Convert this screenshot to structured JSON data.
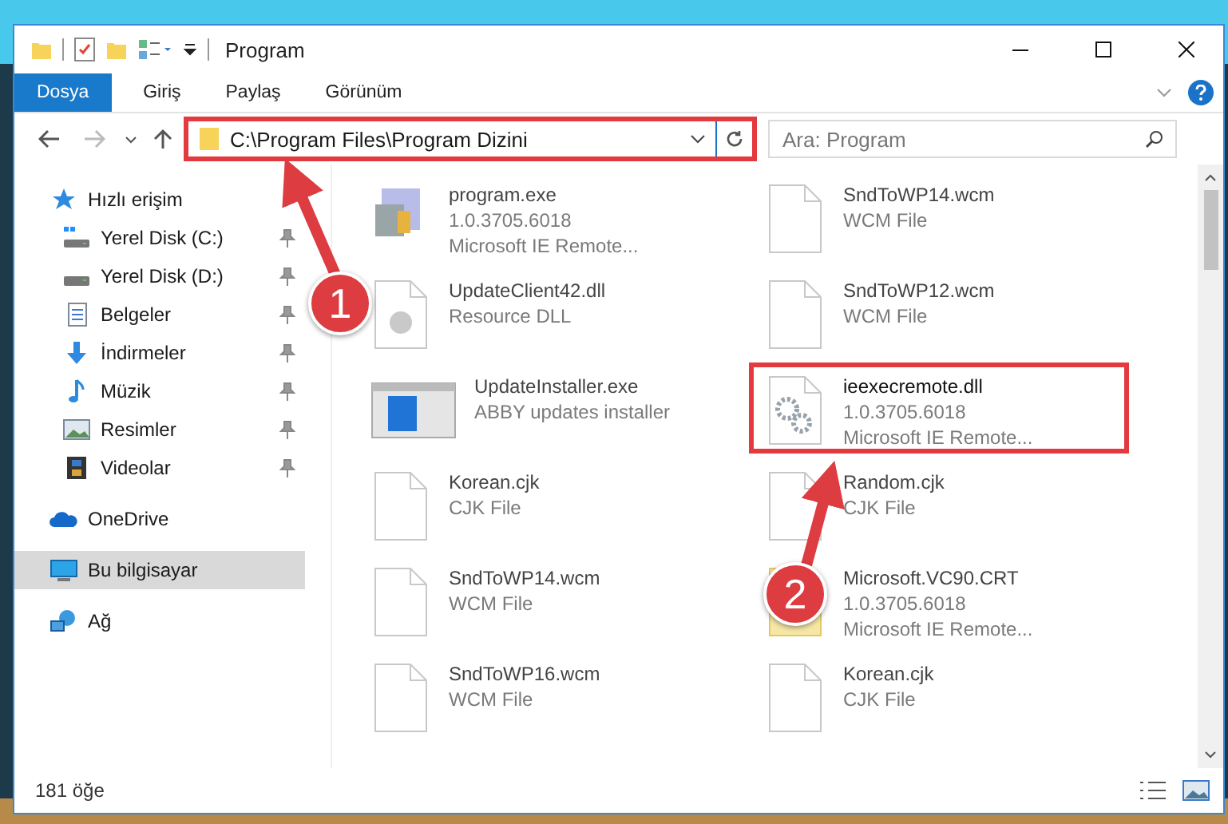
{
  "window": {
    "title": "Program"
  },
  "ribbon_tabs": [
    {
      "label": "Dosya",
      "kind": "file"
    },
    {
      "label": "Giriş",
      "kind": "tab"
    },
    {
      "label": "Paylaş",
      "kind": "tab"
    },
    {
      "label": "Görünüm",
      "kind": "tab"
    }
  ],
  "address": {
    "path": "C:\\Program Files\\Program Dizini",
    "highlighted": true
  },
  "search": {
    "placeholder": "Ara: Program"
  },
  "sidebar": {
    "items": [
      {
        "label": "Hızlı erişim",
        "kind": "star",
        "selected": false,
        "children": [
          {
            "label": "Yerel Disk (C:)",
            "kind": "drive-windows",
            "pinned": true,
            "selected": false
          },
          {
            "label": "Yerel Disk (D:)",
            "kind": "drive",
            "pinned": true,
            "selected": false
          },
          {
            "label": "Belgeler",
            "kind": "document",
            "pinned": true,
            "selected": false
          },
          {
            "label": "İndirmeler",
            "kind": "download",
            "pinned": true,
            "selected": false
          },
          {
            "label": "Müzik",
            "kind": "music",
            "pinned": true,
            "selected": false
          },
          {
            "label": "Resimler",
            "kind": "pictures",
            "pinned": true,
            "selected": false
          },
          {
            "label": "Videolar",
            "kind": "video",
            "pinned": true,
            "selected": false
          }
        ]
      },
      {
        "label": "OneDrive",
        "kind": "cloud",
        "selected": false
      },
      {
        "label": "Bu bilgisayar",
        "kind": "computer",
        "selected": true
      },
      {
        "label": "Ağ",
        "kind": "network",
        "selected": false
      }
    ]
  },
  "files": [
    {
      "name": "program.exe",
      "details": [
        "1.0.3705.6018",
        "Microsoft IE Remote..."
      ],
      "kind": "app",
      "highlighted": false
    },
    {
      "name": "SndToWP14.wcm",
      "details": [
        "WCM File"
      ],
      "kind": "blank",
      "highlighted": false
    },
    {
      "name": "UpdateClient42.dll",
      "details": [
        "Resource DLL"
      ],
      "kind": "dll",
      "highlighted": false
    },
    {
      "name": "SndToWP12.wcm",
      "details": [
        "WCM File"
      ],
      "kind": "blank",
      "highlighted": false
    },
    {
      "name": "UpdateInstaller.exe",
      "details": [
        "ABBY updates installer"
      ],
      "kind": "installer",
      "highlighted": false
    },
    {
      "name": "ieexecremote.dll",
      "details": [
        "1.0.3705.6018",
        "Microsoft IE Remote..."
      ],
      "kind": "gear",
      "highlighted": true
    },
    {
      "name": "Korean.cjk",
      "details": [
        "CJK File"
      ],
      "kind": "blank",
      "highlighted": false
    },
    {
      "name": "Random.cjk",
      "details": [
        "CJK File"
      ],
      "kind": "blank",
      "highlighted": false
    },
    {
      "name": "SndToWP14.wcm",
      "details": [
        "WCM File"
      ],
      "kind": "blank",
      "highlighted": false
    },
    {
      "name": "Microsoft.VC90.CRT",
      "details": [
        "1.0.3705.6018",
        "Microsoft IE Remote..."
      ],
      "kind": "manifest",
      "highlighted": false
    },
    {
      "name": "SndToWP16.wcm",
      "details": [
        "WCM File"
      ],
      "kind": "blank",
      "highlighted": false
    },
    {
      "name": "Korean.cjk",
      "details": [
        "CJK File"
      ],
      "kind": "blank",
      "highlighted": false
    }
  ],
  "status_bar": {
    "count": "181 öğe"
  },
  "annotations": [
    {
      "label": "1"
    },
    {
      "label": "2"
    }
  ]
}
